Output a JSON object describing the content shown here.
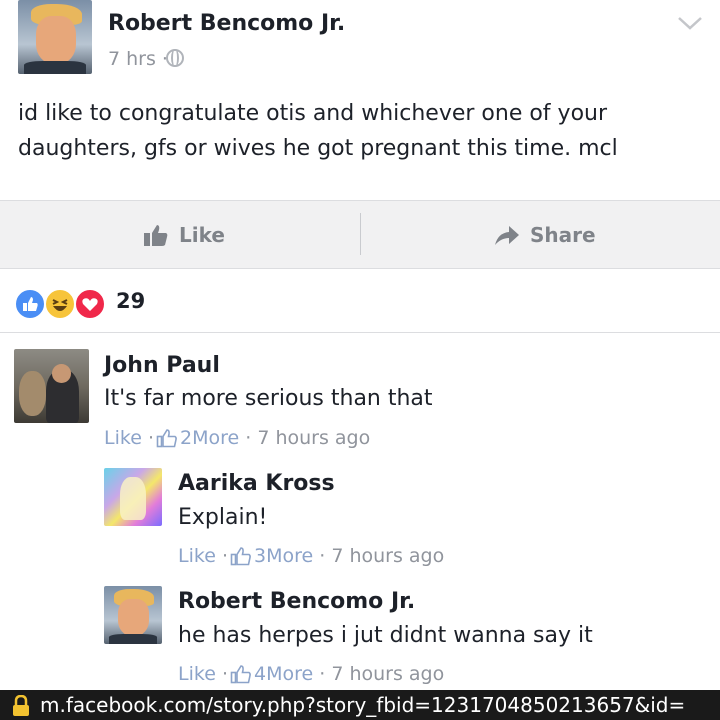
{
  "post": {
    "author": "Robert Bencomo Jr.",
    "time": "7 hrs ·",
    "privacy_icon": "globe-icon",
    "text": "id like to congratulate otis and whichever one of your daughters, gfs or wives he got pregnant this time. mcl"
  },
  "actions": {
    "like_label": "Like",
    "share_label": "Share"
  },
  "reactions": {
    "icons": [
      "like-reaction",
      "haha-reaction",
      "love-reaction"
    ],
    "count": "29"
  },
  "comments": [
    {
      "name": "John Paul",
      "text": "It's far more serious than that",
      "like": "Like",
      "sep1": "·",
      "more": "2More",
      "sep2": "·",
      "time": "7 hours ago"
    },
    {
      "name": "Aarika Kross",
      "text": "Explain!",
      "like": "Like",
      "sep1": "·",
      "more": "3More",
      "sep2": "·",
      "time": "7 hours ago"
    },
    {
      "name": "Robert Bencomo Jr.",
      "text": "he has herpes i jut didnt wanna say it",
      "like": "Like",
      "sep1": "·",
      "more": "4More",
      "sep2": "·",
      "time": "7 hours ago"
    }
  ],
  "url_bar": {
    "url": "m.facebook.com/story.php?story_fbid=1231704850213657&id="
  },
  "colors": {
    "link_blue": "#8ca3c9",
    "meta_gray": "#90949c",
    "like_reaction": "#4a8ef5",
    "haha_reaction": "#f7c43a",
    "love_reaction": "#f0284a"
  }
}
